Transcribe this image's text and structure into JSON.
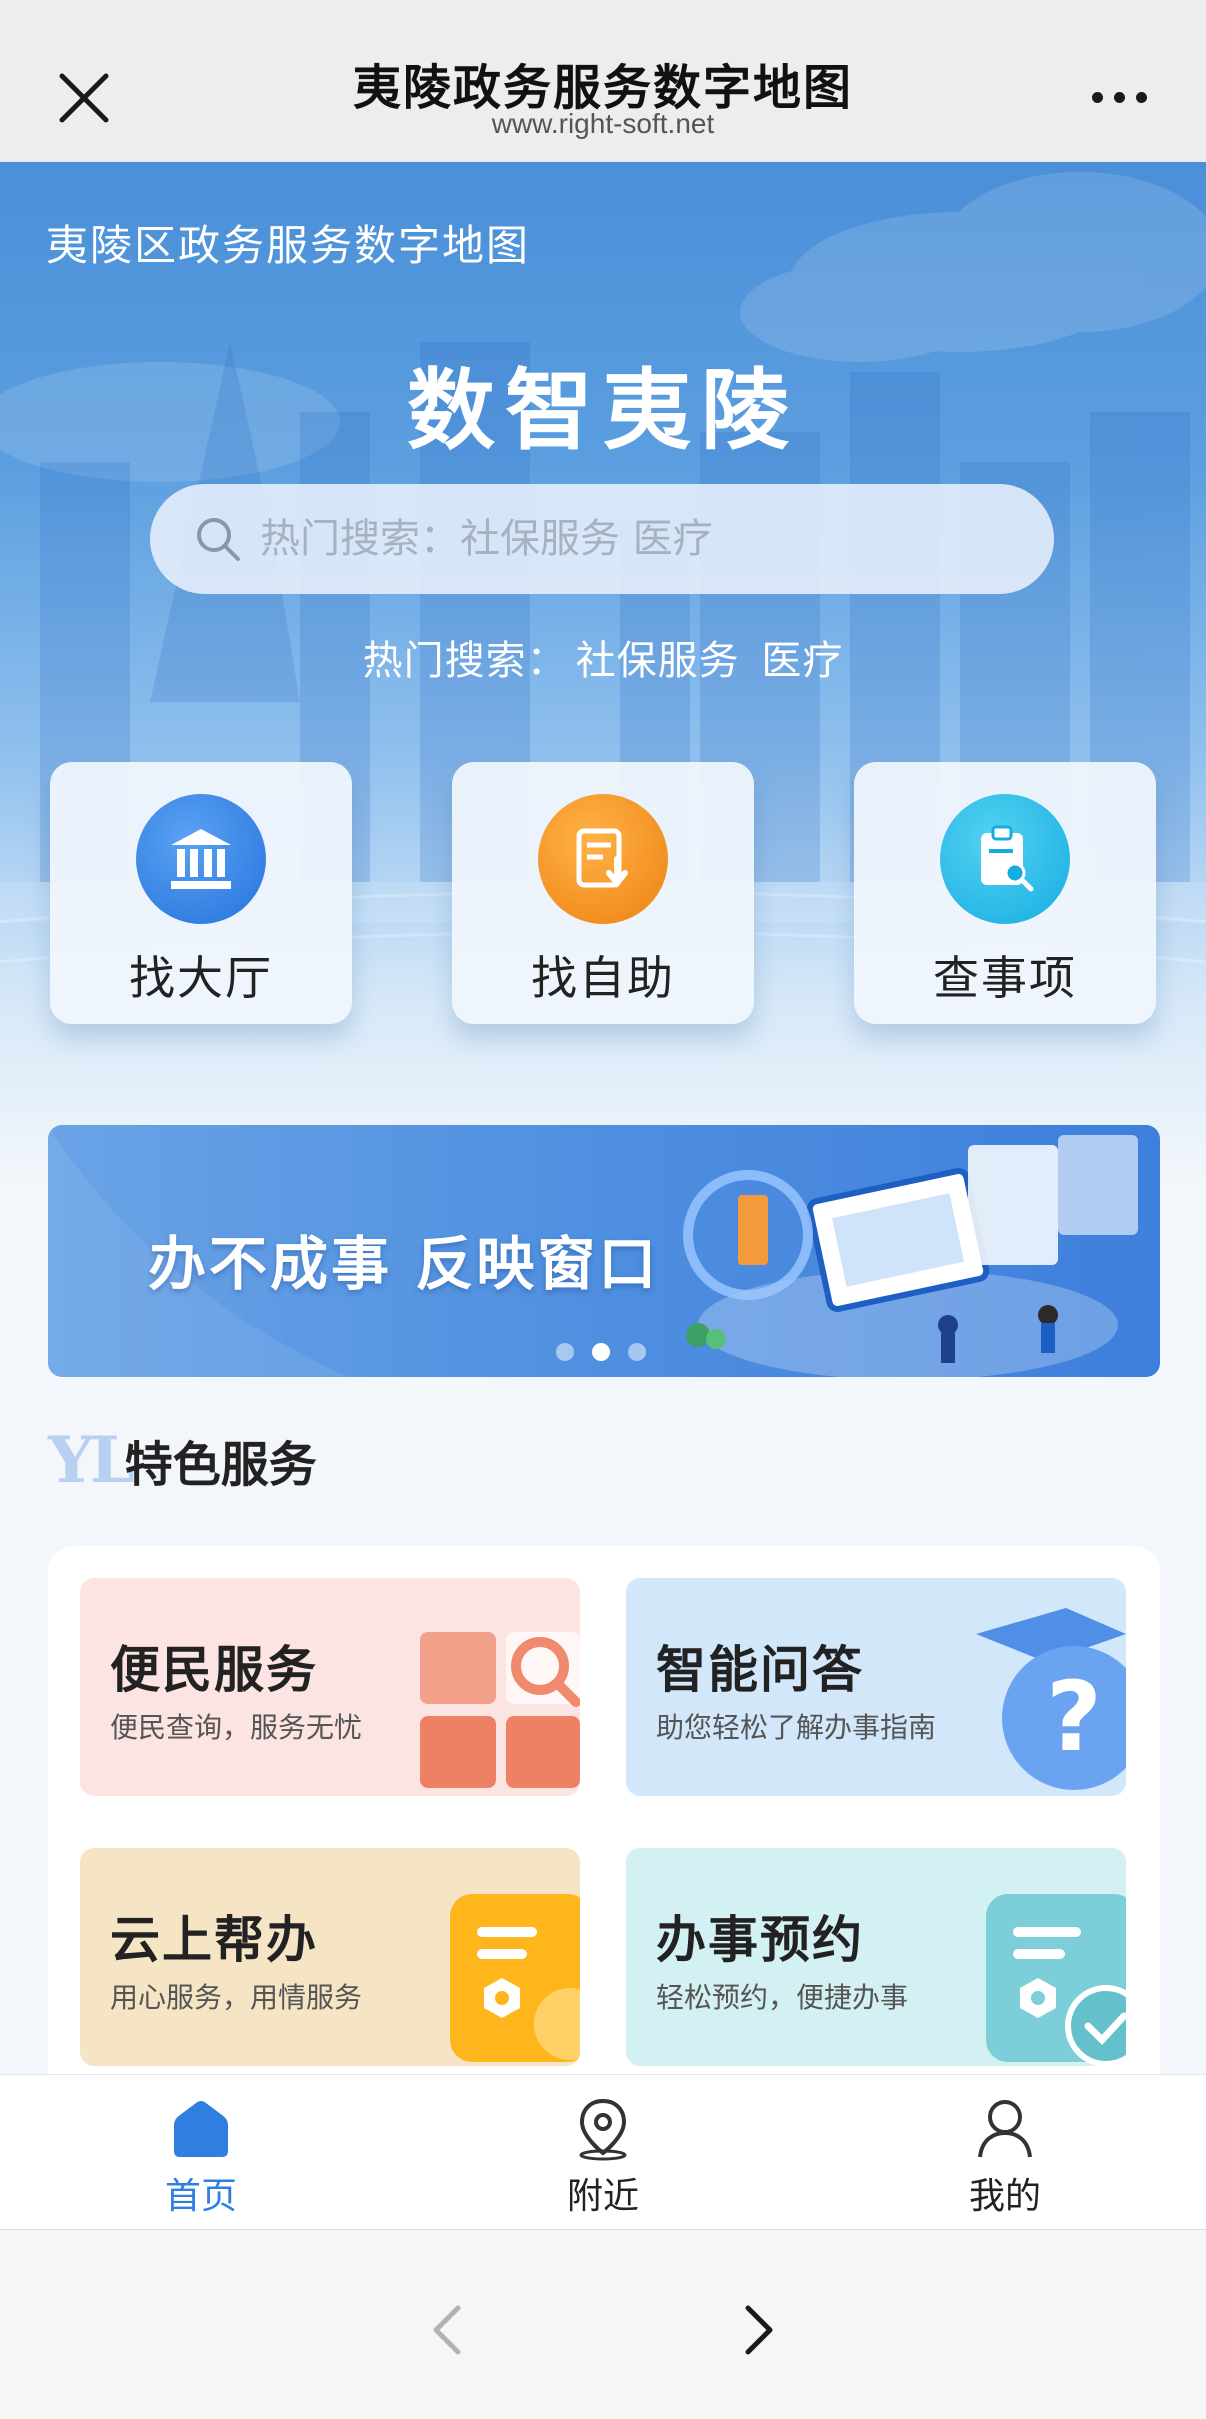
{
  "topbar": {
    "title": "夷陵政务服务数字地图",
    "url": "www.right-soft.net"
  },
  "hero": {
    "subtitle": "夷陵区政务服务数字地图",
    "title": "数智夷陵",
    "search_placeholder": "热门搜索：社保服务 医疗",
    "hot_label": "热门搜索：",
    "hot_items": [
      "社保服务",
      "医疗"
    ]
  },
  "quick_actions": [
    {
      "label": "找大厅",
      "icon": "government-hall-icon",
      "color": "#2f80e6"
    },
    {
      "label": "找自助",
      "icon": "self-service-icon",
      "color": "#f08a1c"
    },
    {
      "label": "查事项",
      "icon": "clipboard-search-icon",
      "color": "#1fb7e0"
    }
  ],
  "banner": {
    "text": "办不成事 反映窗口",
    "active_dot": 2,
    "dot_count": 3
  },
  "featured": {
    "prefix": "YL",
    "title": "特色服务",
    "cards": [
      {
        "title": "便民服务",
        "desc": "便民查询，服务无忧",
        "bg": "#fbe4e1",
        "icon": "grid-search-icon"
      },
      {
        "title": "智能问答",
        "desc": "助您轻松了解办事指南",
        "bg": "#d3e7fa",
        "icon": "question-cap-icon"
      },
      {
        "title": "云上帮办",
        "desc": "用心服务，用情服务",
        "bg": "#f5e5c5",
        "icon": "document-hexagon-icon"
      },
      {
        "title": "办事预约",
        "desc": "轻松预约，便捷办事",
        "bg": "#d3f0f2",
        "icon": "document-check-icon"
      }
    ]
  },
  "tabbar": {
    "tabs": [
      {
        "label": "首页",
        "icon": "home-icon",
        "active": true
      },
      {
        "label": "附近",
        "icon": "location-pin-icon",
        "active": false
      },
      {
        "label": "我的",
        "icon": "user-icon",
        "active": false
      }
    ]
  },
  "colors": {
    "accent": "#2f7fe0",
    "topbar_bg": "#ededed"
  }
}
